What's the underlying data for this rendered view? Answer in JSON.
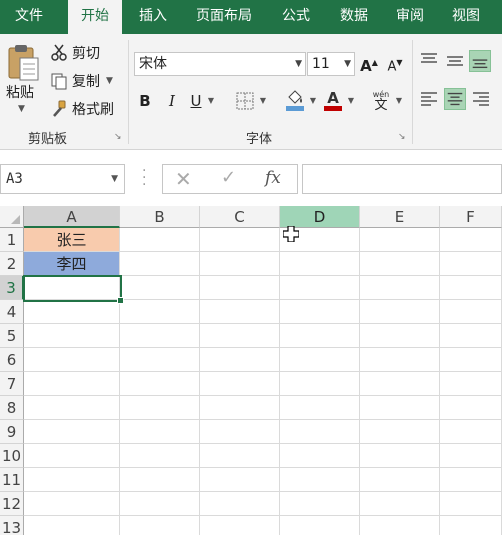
{
  "tabs": {
    "file": "文件",
    "home": "开始",
    "insert": "插入",
    "page_layout": "页面布局",
    "formulas": "公式",
    "data": "数据",
    "review": "审阅",
    "view": "视图"
  },
  "clipboard": {
    "paste": "粘贴",
    "cut": "剪切",
    "copy": "复制",
    "format_painter": "格式刷",
    "group_label": "剪贴板"
  },
  "font": {
    "name": "宋体",
    "size": "11",
    "bold": "B",
    "italic": "I",
    "underline": "U",
    "wen_pinyin": "wén",
    "wen_char": "文",
    "group_label": "字体",
    "font_color": "#c00000",
    "fill_color": "#5b9bd5"
  },
  "formula_bar": {
    "name_box": "A3",
    "formula": ""
  },
  "columns": [
    "A",
    "B",
    "C",
    "D",
    "E",
    "F"
  ],
  "rows": [
    "1",
    "2",
    "3",
    "4",
    "5",
    "6",
    "7",
    "8",
    "9",
    "10",
    "11",
    "12",
    "13"
  ],
  "cells": {
    "A1": "张三",
    "A2": "李四"
  },
  "colors": {
    "accent": "#217346",
    "A1_fill": "#f8cbad",
    "A2_fill": "#8eaadb",
    "hover_column": "#9fd5b7"
  }
}
